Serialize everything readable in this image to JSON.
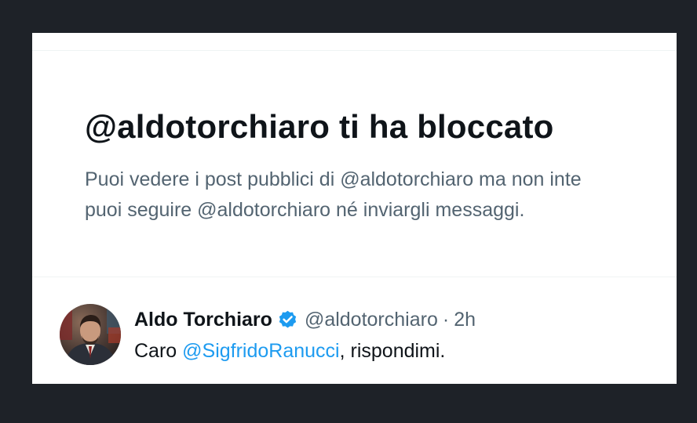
{
  "block_notice": {
    "title": "@aldotorchiaro ti ha bloccato",
    "description_line1": "Puoi vedere i post pubblici di @aldotorchiaro ma non inte",
    "description_line2": "puoi seguire @aldotorchiaro né inviargli messaggi."
  },
  "tweet": {
    "author_name": "Aldo Torchiaro",
    "verified_icon": "verified-badge-icon",
    "author_handle": "@aldotorchiaro",
    "separator": "·",
    "timestamp": "2h",
    "text_prefix": "Caro ",
    "mention": "@SigfridoRanucci",
    "text_suffix": ", rispondimi."
  },
  "colors": {
    "page_background": "#1e2228",
    "card_background": "#ffffff",
    "primary_text": "#0f1419",
    "secondary_text": "#536471",
    "accent": "#1d9bf0"
  }
}
